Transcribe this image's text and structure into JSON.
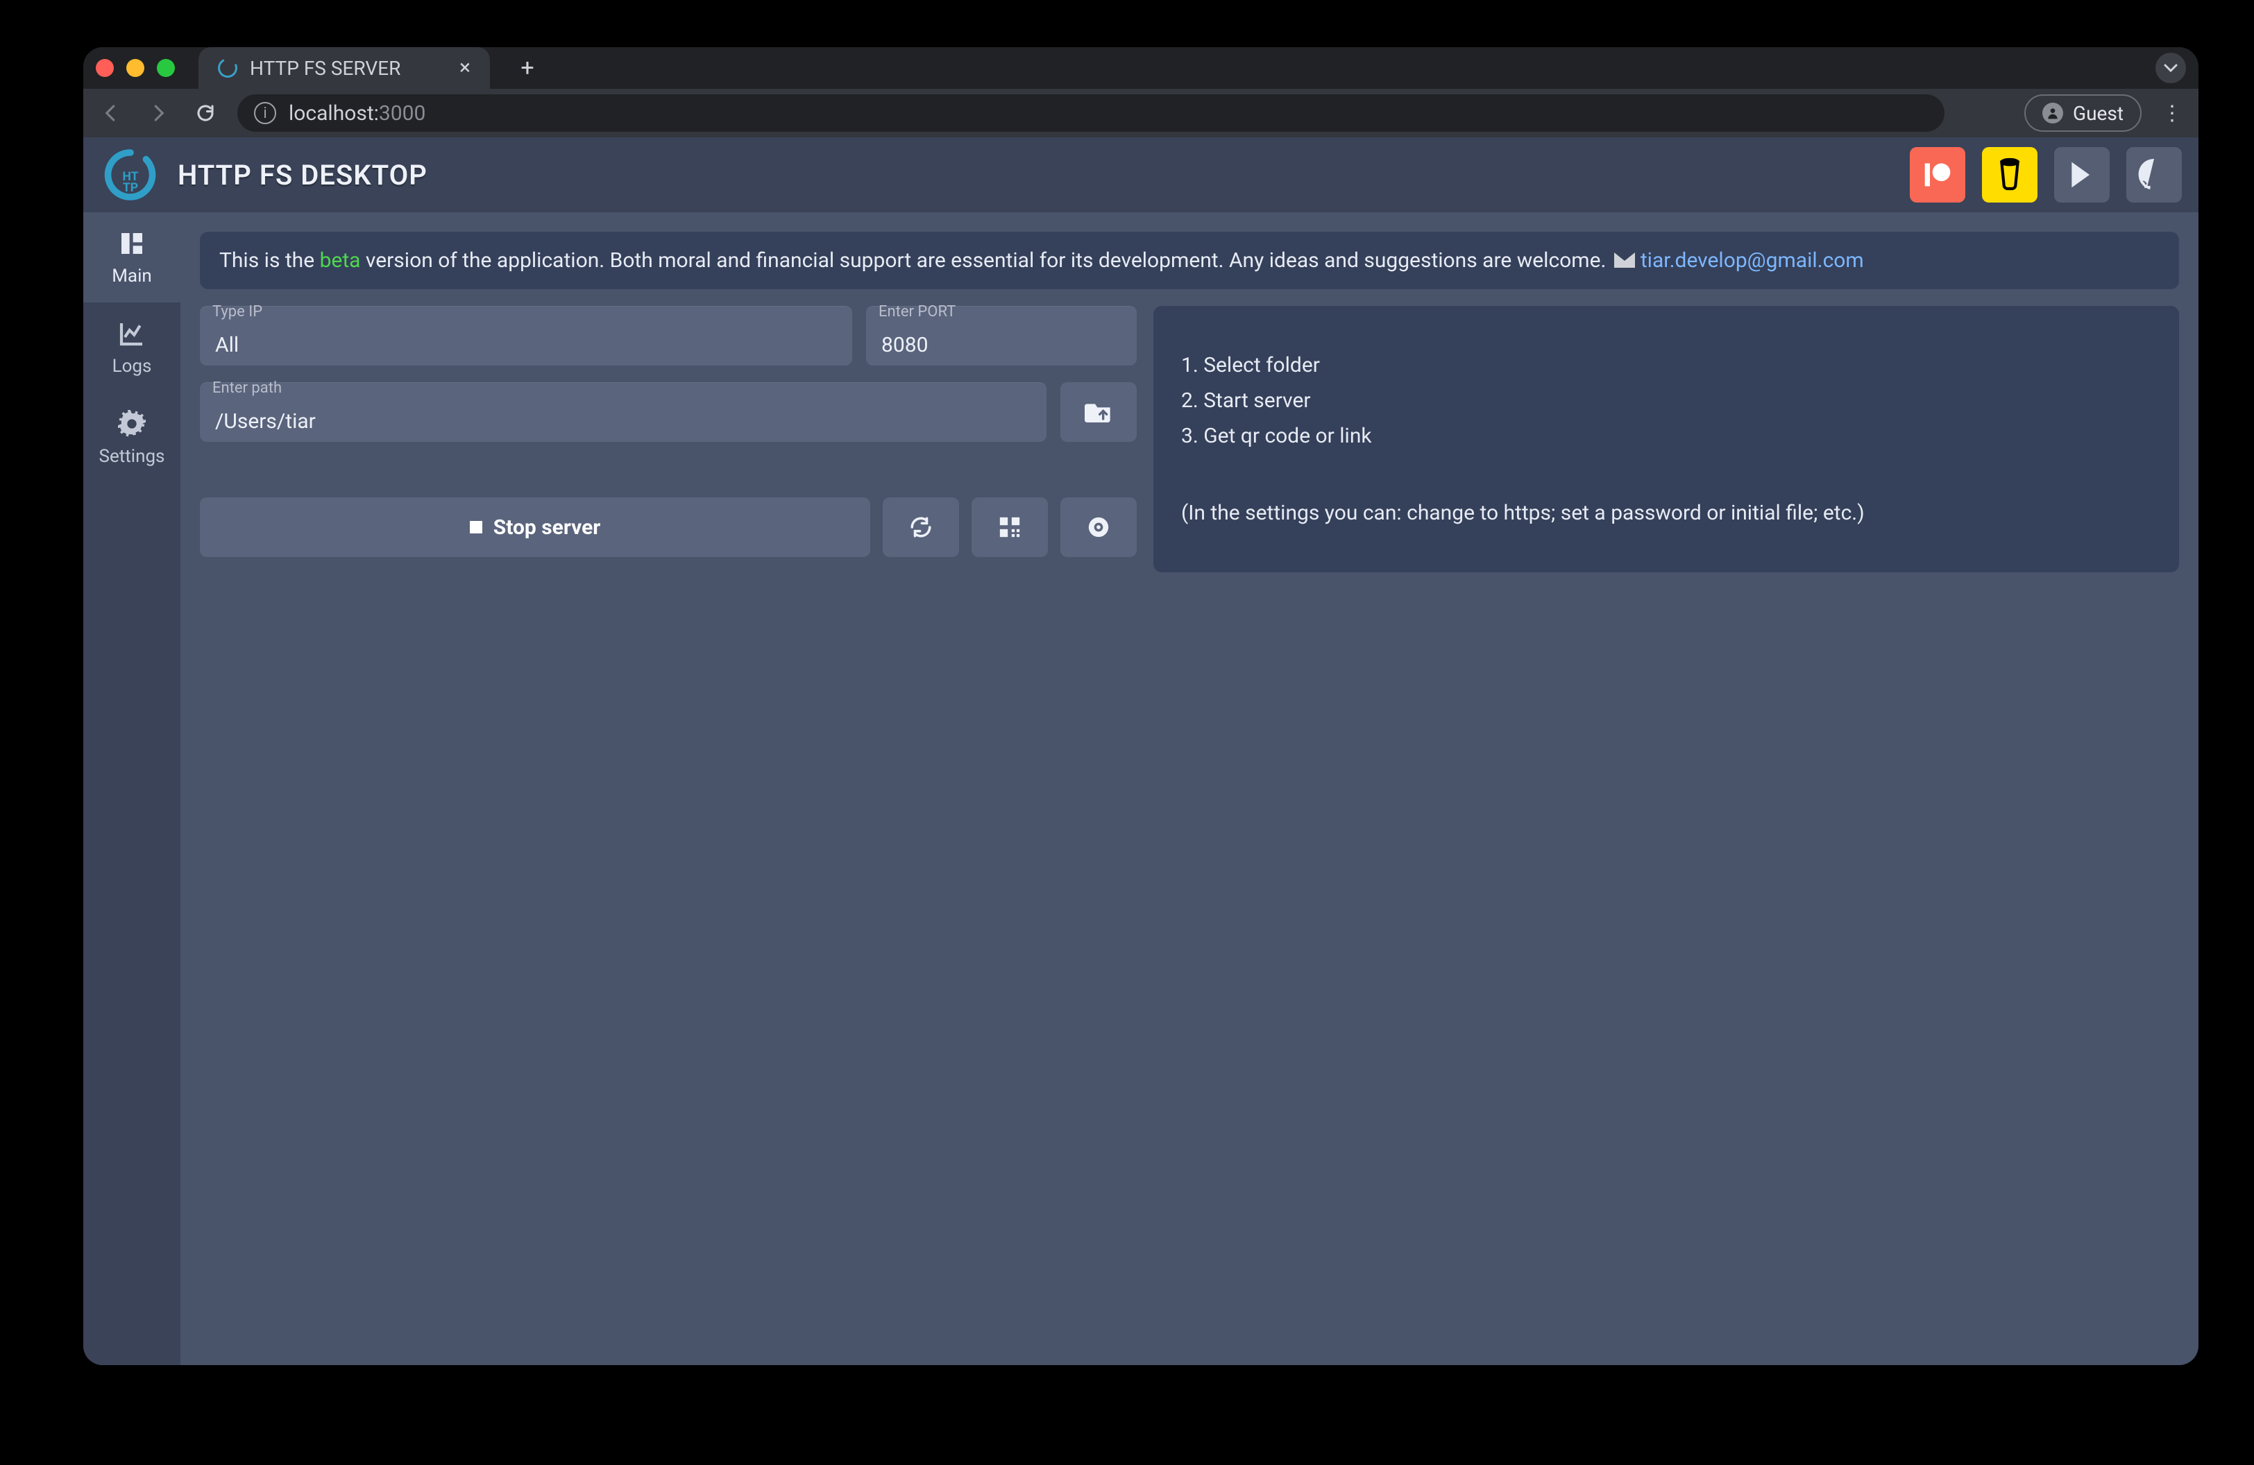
{
  "browser": {
    "tab_title": "HTTP FS SERVER",
    "url_host": "localhost:",
    "url_path": "3000",
    "guest_label": "Guest"
  },
  "header": {
    "title": "HTTP FS DESKTOP"
  },
  "sidebar": {
    "items": [
      {
        "label": "Main"
      },
      {
        "label": "Logs"
      },
      {
        "label": "Settings"
      }
    ]
  },
  "notice": {
    "prefix": "This is the ",
    "beta": "beta",
    "rest": " version of the application. Both moral and financial support are essential for its development. Any ideas and suggestions are welcome. ",
    "email": "tiar.develop@gmail.com"
  },
  "fields": {
    "ip_label": "Type IP",
    "ip_value": "All",
    "port_label": "Enter PORT",
    "port_value": "8080",
    "path_label": "Enter path",
    "path_value": "/Users/tiar"
  },
  "actions": {
    "stop_label": "Stop server"
  },
  "instructions": {
    "steps": [
      "1. Select folder",
      "2. Start server",
      "3. Get qr code or link"
    ],
    "note": "(In the settings you can: change to https; set a password or initial file; etc.)"
  },
  "colors": {
    "patreon": "#f96854",
    "bmc": "#ffdd00",
    "panel": "#35405a",
    "input": "#5a647c"
  }
}
